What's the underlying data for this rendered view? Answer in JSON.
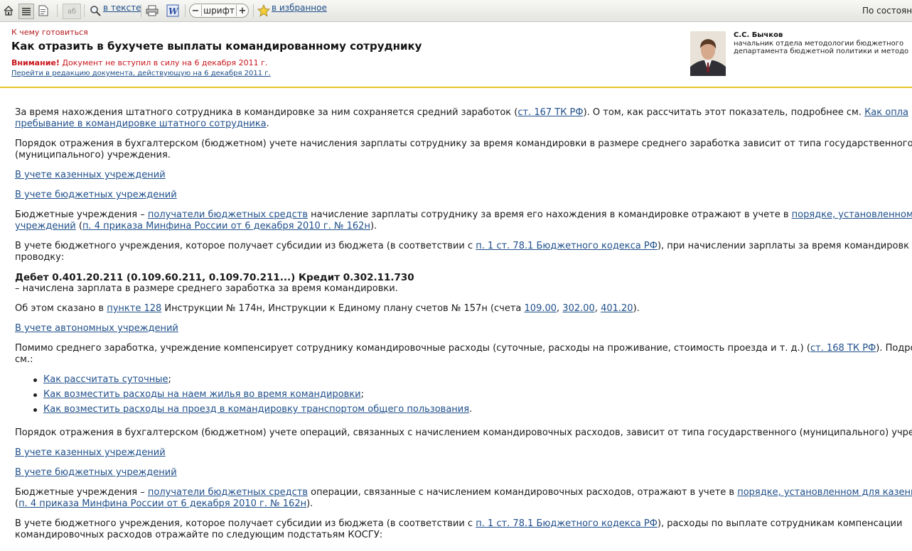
{
  "toolbar": {
    "search_label": "в тексте",
    "font_label": "шрифт",
    "font_minus": "−",
    "font_plus": "+",
    "favorites_label": "в избранное",
    "spell_label": "аб",
    "status_text": "По состояни"
  },
  "header": {
    "kicker": "К чему готовиться",
    "title": "Как отразить в бухучете выплаты командированному сотруднику",
    "warning_label": "Внимание!",
    "warning_text": " Документ не вступил в силу на 6 декабря 2011 г.",
    "redirect_link": "Перейти в редакцию документа, действующую на 6 декабря 2011 г.",
    "author_name": "С.С. Бычков",
    "author_position_1": "начальник отдела методологии бюджетного",
    "author_position_2": "департамента бюджетной политики и методо"
  },
  "article": {
    "p1_a": "За время нахождения штатного сотрудника в командировке за ним сохраняется средний заработок (",
    "p1_link1": "ст. 167 ТК РФ",
    "p1_b": "). О том, как рассчитать этот показатель, подробнее см. ",
    "p1_link2": "Как опла",
    "p1_link3": "пребывание в командировке штатного сотрудника",
    "p1_c": ".",
    "p2_line1": "Порядок отражения в бухгалтерском (бюджетном) учете начисления зарплаты сотруднику за время командировки в размере среднего заработка зависит от типа государственного",
    "p2_line2": "(муниципального) учреждения.",
    "link_kazennye_1": "В учете казенных учреждений",
    "link_budget_1": "В учете бюджетных учреждений",
    "p3_a": "Бюджетные учреждения – ",
    "p3_link1": "получатели бюджетных средств",
    "p3_b": " начисление зарплаты сотруднику за время его нахождения в командировке отражают в учете в ",
    "p3_link2": "порядке, установленном д",
    "p3_link3": "учреждений",
    "p3_c": " (",
    "p3_link4": "п. 4 приказа Минфина России от 6 декабря 2010 г. № 162н",
    "p3_d": ").",
    "p4_a": "В учете бюджетного учреждения, которое получает субсидии из бюджета (в соответствии с ",
    "p4_link1": "п. 1 ст. 78.1 Бюджетного кодекса РФ",
    "p4_b": "), при начислении зарплаты за время командировк",
    "p4_line2": "проводку:",
    "entry_bold": "Дебет 0.401.20.211 (0.109.60.211, 0.109.70.211...) Кредит 0.302.11.730",
    "entry_desc": "– начислена зарплата в размере среднего заработка за время командировки.",
    "p5_a": "Об этом сказано в ",
    "p5_link1": "пункте 128",
    "p5_b": " Инструкции № 174н, Инструкции к Единому плану счетов № 157н (счета ",
    "p5_link2": "109.00",
    "p5_sep1": ", ",
    "p5_link3": "302.00",
    "p5_sep2": ", ",
    "p5_link4": "401.20",
    "p5_c": ").",
    "link_avtonom": "В учете автономных учреждений",
    "p6_a": "Помимо среднего заработка, учреждение компенсирует сотруднику командировочные расходы (суточные, расходы на проживание, стоимость проезда и т. д.) (",
    "p6_link1": "ст. 168 ТК РФ",
    "p6_b": "). Подро",
    "p6_line2": "см.:",
    "list": [
      {
        "link": "Как рассчитать суточные",
        "tail": ";"
      },
      {
        "link": "Как возместить расходы на наем жилья во время командировки",
        "tail": ";"
      },
      {
        "link": "Как возместить расходы на проезд в командировку транспортом общего пользования",
        "tail": "."
      }
    ],
    "p7": "Порядок отражения в бухгалтерском (бюджетном) учете операций, связанных с начислением командировочных расходов, зависит от типа государственного (муниципального) учреж",
    "link_kazennye_2": "В учете казенных учреждений",
    "link_budget_2": "В учете бюджетных учреждений",
    "p8_a": "Бюджетные учреждения – ",
    "p8_link1": "получатели бюджетных средств",
    "p8_b": " операции, связанные с начислением командировочных расходов, отражают в учете в ",
    "p8_link2": "порядке, установленном для казенн",
    "p8_c": "(",
    "p8_link3": "п. 4 приказа Минфина России от 6 декабря 2010 г. № 162н",
    "p8_d": ").",
    "p9_a": "В учете бюджетного учреждения, которое получает субсидии из бюджета (в соответствии с ",
    "p9_link1": "п. 1 ст. 78.1 Бюджетного кодекса РФ",
    "p9_b": "), расходы по выплате сотрудникам компенсации",
    "p9_line2": "командировочных расходов отражайте по следующим подстатьям КОСГУ:"
  }
}
